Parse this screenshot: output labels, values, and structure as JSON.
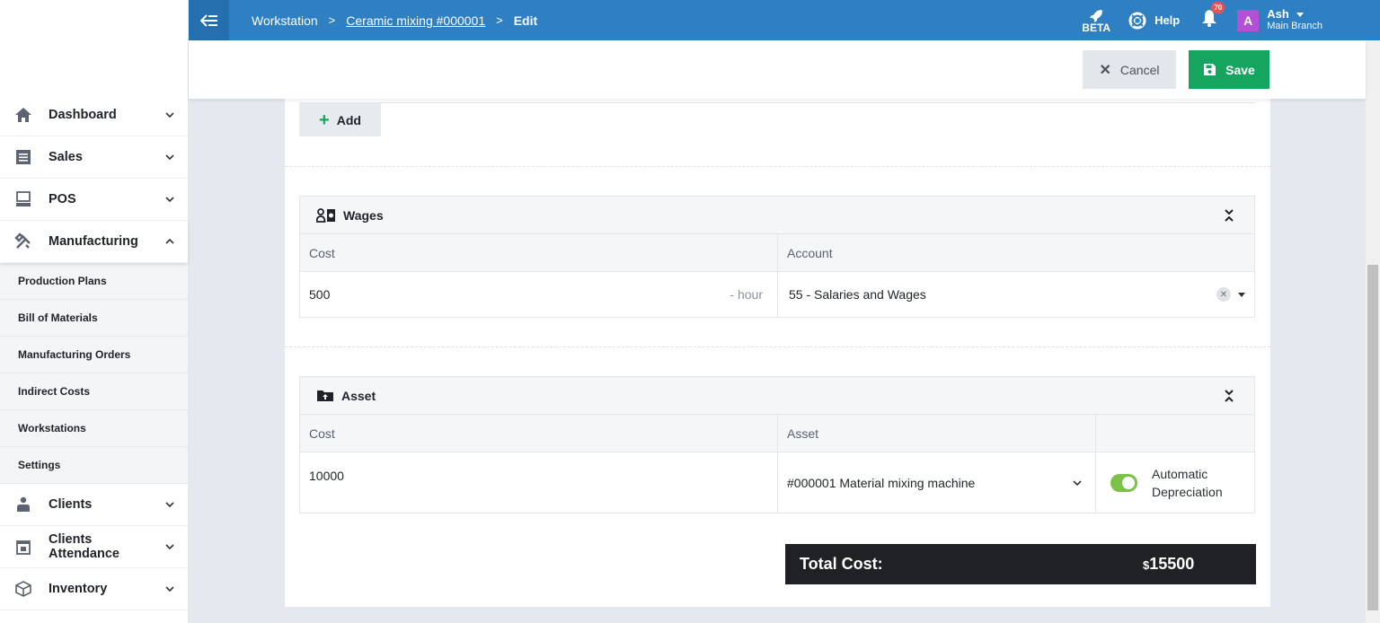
{
  "sidebar": {
    "items_top": [
      {
        "label": "Dashboard",
        "icon": "home-icon"
      },
      {
        "label": "Sales",
        "icon": "receipt-icon"
      },
      {
        "label": "POS",
        "icon": "pos-icon"
      },
      {
        "label": "Manufacturing",
        "icon": "tools-icon"
      }
    ],
    "submenu": [
      "Production Plans",
      "Bill of Materials",
      "Manufacturing Orders",
      "Indirect Costs",
      "Workstations",
      "Settings"
    ],
    "items_bottom": [
      {
        "label": "Clients",
        "icon": "clients-icon"
      },
      {
        "label": "Clients Attendance",
        "icon": "calendar-icon"
      },
      {
        "label": "Inventory",
        "icon": "box-icon"
      }
    ]
  },
  "header": {
    "breadcrumb": [
      "Workstation",
      "Ceramic mixing #000001",
      "Edit"
    ],
    "beta_label": "BETA",
    "help_label": "Help",
    "notification_count": "70",
    "user": {
      "initial": "A",
      "name": "Ash",
      "branch": "Main Branch"
    }
  },
  "actions": {
    "cancel_label": "Cancel",
    "save_label": "Save"
  },
  "main": {
    "add_label": "Add",
    "wages": {
      "title": "Wages",
      "cost_header": "Cost",
      "account_header": "Account",
      "cost_value": "500",
      "unit": "- hour",
      "account_value": "55 - Salaries and Wages"
    },
    "asset": {
      "title": "Asset",
      "cost_header": "Cost",
      "asset_header": "Asset",
      "cost_value": "10000",
      "asset_value": "#000001 Material mixing machine",
      "toggle_label_1": "Automatic",
      "toggle_label_2": "Depreciation",
      "toggle_on": true
    },
    "total_label": "Total Cost:",
    "total_currency": "$",
    "total_value": "15500"
  },
  "colors": {
    "header": "#2f80c2",
    "save": "#16a55e",
    "toggle": "#7cc14a",
    "total_bg": "#1f2124"
  }
}
